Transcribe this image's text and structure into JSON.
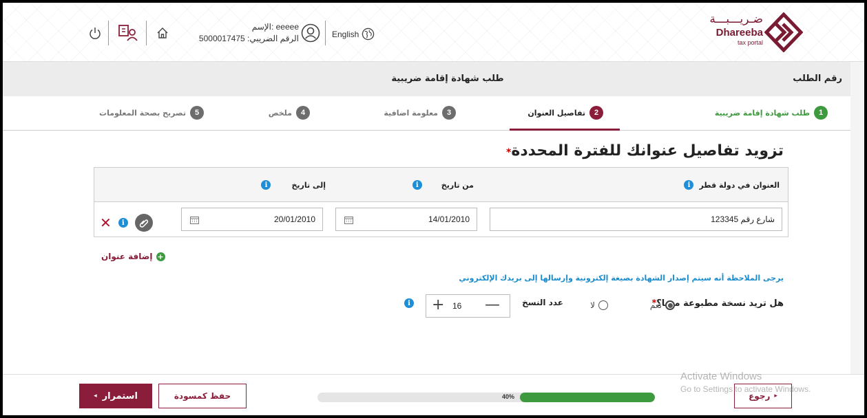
{
  "header": {
    "logo_arabic": "ضـريـــبـــة",
    "logo_english": "Dhareeba",
    "logo_sub": "tax portal",
    "language_label": "English",
    "user_name_line": "الإسم: eeeee",
    "user_tin_line": "الرقم الضريبي: 5000017475",
    "icons": [
      "home-icon",
      "switch-account-icon",
      "power-icon",
      "user-icon",
      "globe-icon"
    ]
  },
  "titlebar": {
    "request_number_label": "رقم الطلب",
    "request_title": "طلب شهادة إقامة ضريبية"
  },
  "steps": [
    {
      "num": "1",
      "label": "طلب شهادة إقامة ضريبية",
      "state": "done"
    },
    {
      "num": "2",
      "label": "تفاصيل العنوان",
      "state": "active"
    },
    {
      "num": "3",
      "label": "معلومة اضافية",
      "state": "pending"
    },
    {
      "num": "4",
      "label": "ملخص",
      "state": "pending"
    },
    {
      "num": "5",
      "label": "تصريح بصحة المعلومات",
      "state": "pending"
    }
  ],
  "main": {
    "heading": "تزويد تفاصيل عنوانك للفترة المحددة",
    "required_mark": "*",
    "table": {
      "col_address": "العنوان في دولة قطر",
      "col_from": "من تاريخ",
      "col_to": "إلى تاريخ",
      "rows": [
        {
          "address": "شارع رقم 123345",
          "from": "14/01/2010",
          "to": "20/01/2010"
        }
      ]
    },
    "add_address": "إضافة عنوان",
    "note": "يرجى الملاحظة أنه سيتم إصدار الشهادة بصيغة إلكترونية وإرسالها إلى بريدك الإلكتروني",
    "question": "هل تريد نسخة مطبوعة منها؟",
    "question_required": "*",
    "option_yes": "نعم",
    "option_no": "لا",
    "selected_option": "yes",
    "copies_label": "عدد النسخ",
    "copies_value": "16"
  },
  "footer": {
    "continue_label": "استمرار",
    "save_draft_label": "حفظ كمسودة",
    "back_label": "رجوع",
    "progress_label": "40%",
    "progress_value": 0.4
  },
  "watermark": {
    "line1": "Activate Windows",
    "line2": "Go to Settings to activate Windows."
  },
  "colors": {
    "brand": "#8a1d3a",
    "success": "#3e9a3e",
    "info": "#1e8fd6",
    "note_text": "#1a8ccc"
  }
}
